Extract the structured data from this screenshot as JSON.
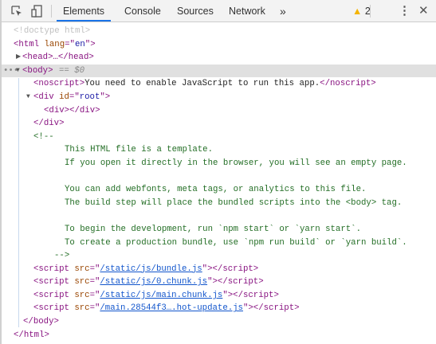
{
  "toolbar": {
    "tabs": [
      {
        "label": "Elements",
        "active": true
      },
      {
        "label": "Console"
      },
      {
        "label": "Sources"
      },
      {
        "label": "Network"
      }
    ],
    "more_tabs": "»",
    "warning_count": "2",
    "accent": "#1a73e8"
  },
  "dom": {
    "doctype": "<!doctype html>",
    "html_open": [
      "<html ",
      "lang",
      "=\"",
      "en",
      "\">"
    ],
    "head": "<head>…</head>",
    "body": "<body>",
    "body_marker": "== $0",
    "noscript": [
      "<noscript>",
      "You need to enable JavaScript to run this app.",
      "</noscript>"
    ],
    "div_root": [
      "<div ",
      "id",
      "=\"",
      "root",
      "\">"
    ],
    "inner_div": "<div></div>",
    "div_close": "</div>",
    "comment_open": "<!--",
    "comment_lines": [
      "This HTML file is a template.",
      "If you open it directly in the browser, you will see an empty page.",
      "",
      "You can add webfonts, meta tags, or analytics to this file.",
      "The build step will place the bundled scripts into the <body> tag.",
      "",
      "To begin the development, run `npm start` or `yarn start`.",
      "To create a production bundle, use `npm run build` or `yarn build`."
    ],
    "comment_close": "-->",
    "scripts": [
      "/static/js/bundle.js",
      "/static/js/0.chunk.js",
      "/static/js/main.chunk.js",
      "/main.28544f3….hot-update.js"
    ],
    "script_open": "<script ",
    "src_attr": "src",
    "eq_quote": "=\"",
    "script_close": "\"></script>",
    "body_close": "</body>",
    "html_close": "</html>"
  }
}
